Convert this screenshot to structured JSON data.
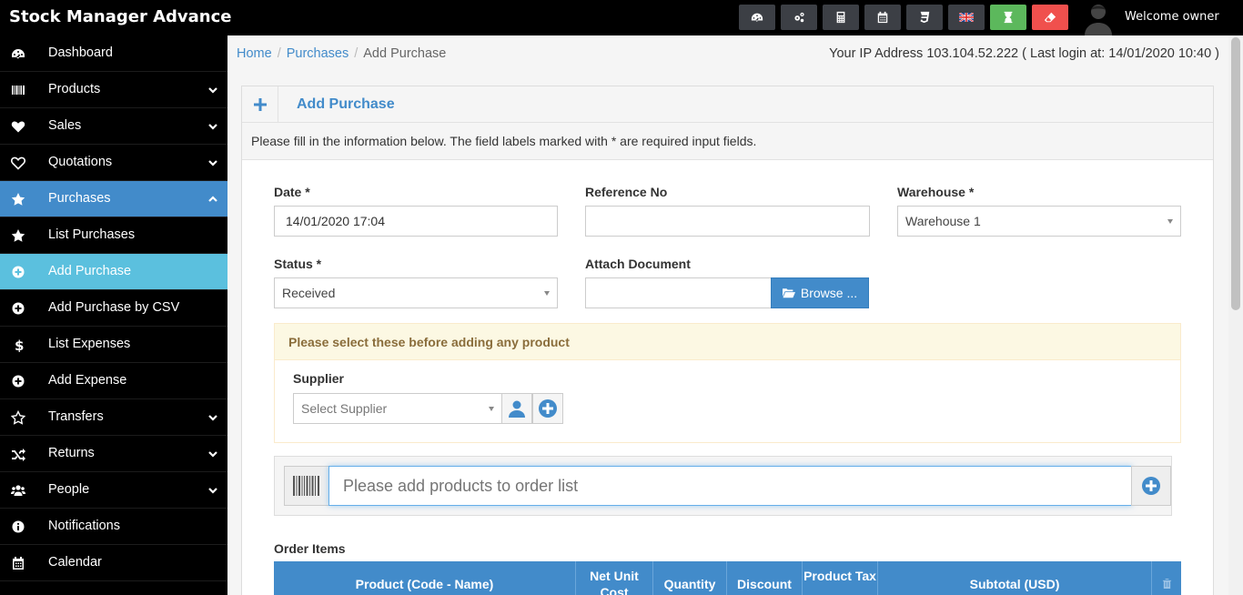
{
  "app": {
    "brand": "Stock Manager Advance",
    "welcome": "Welcome owner"
  },
  "header_buttons": [
    {
      "name": "dashboard-button",
      "icon": "dashboard-icon"
    },
    {
      "name": "settings-button",
      "icon": "cogs-icon"
    },
    {
      "name": "calculator-button",
      "icon": "calculator-icon"
    },
    {
      "name": "calendar-button",
      "icon": "calendar-icon"
    },
    {
      "name": "styles-button",
      "icon": "css3-icon"
    },
    {
      "name": "language-button",
      "icon": "uk-flag-icon"
    },
    {
      "name": "alerts-button",
      "icon": "hourglass-icon"
    },
    {
      "name": "clear-cache-button",
      "icon": "eraser-icon"
    }
  ],
  "sidebar": {
    "items": [
      {
        "label": "Dashboard",
        "icon": "dashboard-icon",
        "has_chevron": false
      },
      {
        "label": "Products",
        "icon": "barcode-icon",
        "has_chevron": true
      },
      {
        "label": "Sales",
        "icon": "heart-icon",
        "has_chevron": true
      },
      {
        "label": "Quotations",
        "icon": "heart-outline-icon",
        "has_chevron": true
      },
      {
        "label": "Purchases",
        "icon": "star-icon",
        "has_chevron": true,
        "active": true
      },
      {
        "label": "List Purchases",
        "icon": "star-icon",
        "has_chevron": false
      },
      {
        "label": "Add Purchase",
        "icon": "plus-circle-icon",
        "has_chevron": false,
        "sub_active": true
      },
      {
        "label": "Add Purchase by CSV",
        "icon": "plus-circle-icon",
        "has_chevron": false
      },
      {
        "label": "List Expenses",
        "icon": "dollar-icon",
        "has_chevron": false
      },
      {
        "label": "Add Expense",
        "icon": "plus-circle-icon",
        "has_chevron": false
      },
      {
        "label": "Transfers",
        "icon": "star-outline-icon",
        "has_chevron": true
      },
      {
        "label": "Returns",
        "icon": "random-icon",
        "has_chevron": true
      },
      {
        "label": "People",
        "icon": "users-icon",
        "has_chevron": true
      },
      {
        "label": "Notifications",
        "icon": "info-circle-icon",
        "has_chevron": false
      },
      {
        "label": "Calendar",
        "icon": "calendar-icon",
        "has_chevron": false
      }
    ]
  },
  "breadcrumb": {
    "home": "Home",
    "purchases": "Purchases",
    "current": "Add Purchase",
    "sep": "/"
  },
  "ip_info": "Your IP Address 103.104.52.222 ( Last login at: 14/01/2020 10:40 )",
  "box": {
    "title": "Add Purchase",
    "intro": "Please fill in the information below. The field labels marked with * are required input fields."
  },
  "form": {
    "date_label": "Date *",
    "date_value": "14/01/2020 17:04",
    "ref_label": "Reference No",
    "ref_value": "",
    "warehouse_label": "Warehouse *",
    "warehouse_value": "Warehouse 1",
    "status_label": "Status *",
    "status_value": "Received",
    "attach_label": "Attach Document",
    "browse_label": "Browse ...",
    "notice": "Please select these before adding any product",
    "supplier_label": "Supplier",
    "supplier_placeholder": "Select Supplier",
    "add_product_placeholder": "Please add products to order list",
    "order_items_label": "Order Items"
  },
  "table": {
    "columns": [
      "Product (Code - Name)",
      "Net Unit Cost",
      "Quantity",
      "Discount",
      "Product Tax",
      "Subtotal (USD)"
    ]
  },
  "colors": {
    "primary": "#428bca",
    "sub_active": "#5bc0de",
    "green": "#5cb85c",
    "red": "#f0504d",
    "warning_bg": "#fcf8e3"
  }
}
